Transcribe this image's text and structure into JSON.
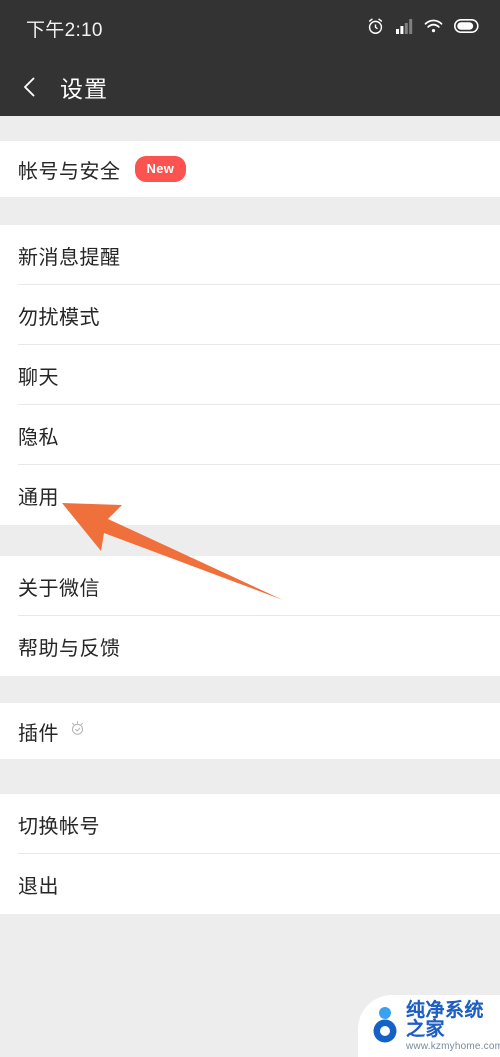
{
  "status_bar": {
    "time": "下午2:10",
    "icons": [
      "alarm-icon",
      "signal-icon",
      "wifi-icon",
      "battery-icon"
    ]
  },
  "header": {
    "back_icon": "back-chevron-icon",
    "title": "设置"
  },
  "sections": [
    {
      "name": "account-section",
      "items": [
        {
          "label": "帐号与安全",
          "badge": "New"
        }
      ]
    },
    {
      "name": "preferences-section",
      "items": [
        {
          "label": "新消息提醒"
        },
        {
          "label": "勿扰模式"
        },
        {
          "label": "聊天"
        },
        {
          "label": "隐私"
        },
        {
          "label": "通用"
        }
      ]
    },
    {
      "name": "about-section",
      "items": [
        {
          "label": "关于微信"
        },
        {
          "label": "帮助与反馈"
        }
      ]
    },
    {
      "name": "plugins-section",
      "items": [
        {
          "label": "插件",
          "icon": "plugin-badge-icon"
        }
      ]
    },
    {
      "name": "account-actions-section",
      "items": [
        {
          "label": "切换帐号"
        },
        {
          "label": "退出"
        }
      ]
    }
  ],
  "annotation": {
    "name": "orange-pointer-arrow",
    "target_label": "通用",
    "color": "#f0703c"
  },
  "watermark": {
    "title": "纯净系统之家",
    "url": "www.kzmyhome.com",
    "logo": "blue-person-circle-logo"
  },
  "colors": {
    "status_bar_bg": "#333333",
    "page_bg": "#ededed",
    "card_bg": "#ffffff",
    "badge_red": "#fb5450",
    "text_primary": "#262626",
    "arrow_orange": "#f0703c"
  }
}
